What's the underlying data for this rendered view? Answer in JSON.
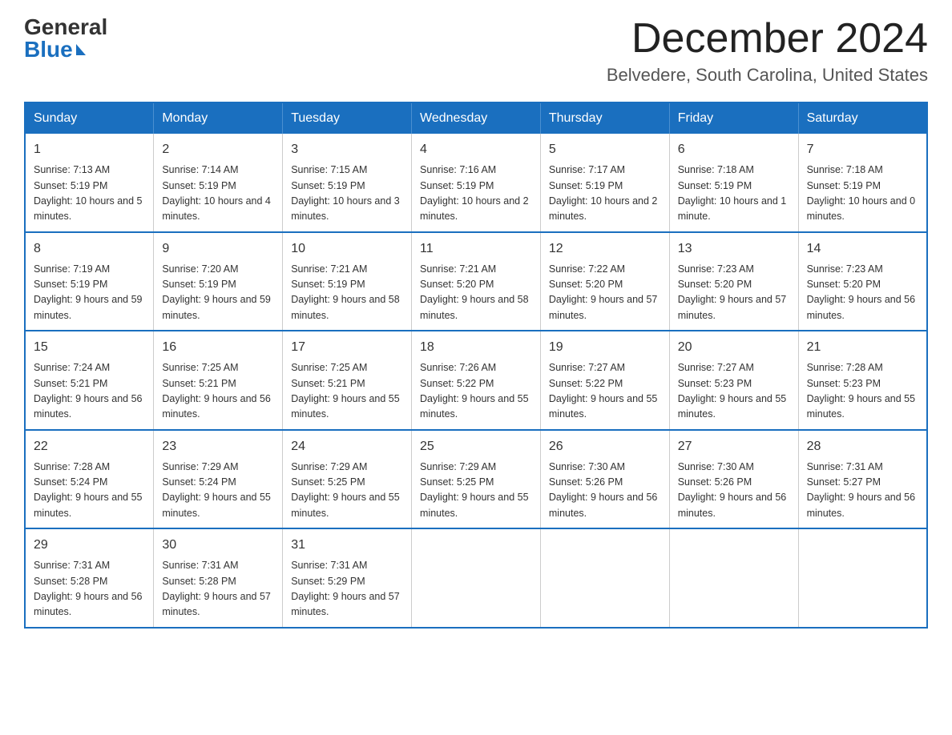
{
  "logo": {
    "general": "General",
    "blue": "Blue"
  },
  "title": "December 2024",
  "location": "Belvedere, South Carolina, United States",
  "days_of_week": [
    "Sunday",
    "Monday",
    "Tuesday",
    "Wednesday",
    "Thursday",
    "Friday",
    "Saturday"
  ],
  "weeks": [
    [
      {
        "day": "1",
        "sunrise": "7:13 AM",
        "sunset": "5:19 PM",
        "daylight": "10 hours and 5 minutes."
      },
      {
        "day": "2",
        "sunrise": "7:14 AM",
        "sunset": "5:19 PM",
        "daylight": "10 hours and 4 minutes."
      },
      {
        "day": "3",
        "sunrise": "7:15 AM",
        "sunset": "5:19 PM",
        "daylight": "10 hours and 3 minutes."
      },
      {
        "day": "4",
        "sunrise": "7:16 AM",
        "sunset": "5:19 PM",
        "daylight": "10 hours and 2 minutes."
      },
      {
        "day": "5",
        "sunrise": "7:17 AM",
        "sunset": "5:19 PM",
        "daylight": "10 hours and 2 minutes."
      },
      {
        "day": "6",
        "sunrise": "7:18 AM",
        "sunset": "5:19 PM",
        "daylight": "10 hours and 1 minute."
      },
      {
        "day": "7",
        "sunrise": "7:18 AM",
        "sunset": "5:19 PM",
        "daylight": "10 hours and 0 minutes."
      }
    ],
    [
      {
        "day": "8",
        "sunrise": "7:19 AM",
        "sunset": "5:19 PM",
        "daylight": "9 hours and 59 minutes."
      },
      {
        "day": "9",
        "sunrise": "7:20 AM",
        "sunset": "5:19 PM",
        "daylight": "9 hours and 59 minutes."
      },
      {
        "day": "10",
        "sunrise": "7:21 AM",
        "sunset": "5:19 PM",
        "daylight": "9 hours and 58 minutes."
      },
      {
        "day": "11",
        "sunrise": "7:21 AM",
        "sunset": "5:20 PM",
        "daylight": "9 hours and 58 minutes."
      },
      {
        "day": "12",
        "sunrise": "7:22 AM",
        "sunset": "5:20 PM",
        "daylight": "9 hours and 57 minutes."
      },
      {
        "day": "13",
        "sunrise": "7:23 AM",
        "sunset": "5:20 PM",
        "daylight": "9 hours and 57 minutes."
      },
      {
        "day": "14",
        "sunrise": "7:23 AM",
        "sunset": "5:20 PM",
        "daylight": "9 hours and 56 minutes."
      }
    ],
    [
      {
        "day": "15",
        "sunrise": "7:24 AM",
        "sunset": "5:21 PM",
        "daylight": "9 hours and 56 minutes."
      },
      {
        "day": "16",
        "sunrise": "7:25 AM",
        "sunset": "5:21 PM",
        "daylight": "9 hours and 56 minutes."
      },
      {
        "day": "17",
        "sunrise": "7:25 AM",
        "sunset": "5:21 PM",
        "daylight": "9 hours and 55 minutes."
      },
      {
        "day": "18",
        "sunrise": "7:26 AM",
        "sunset": "5:22 PM",
        "daylight": "9 hours and 55 minutes."
      },
      {
        "day": "19",
        "sunrise": "7:27 AM",
        "sunset": "5:22 PM",
        "daylight": "9 hours and 55 minutes."
      },
      {
        "day": "20",
        "sunrise": "7:27 AM",
        "sunset": "5:23 PM",
        "daylight": "9 hours and 55 minutes."
      },
      {
        "day": "21",
        "sunrise": "7:28 AM",
        "sunset": "5:23 PM",
        "daylight": "9 hours and 55 minutes."
      }
    ],
    [
      {
        "day": "22",
        "sunrise": "7:28 AM",
        "sunset": "5:24 PM",
        "daylight": "9 hours and 55 minutes."
      },
      {
        "day": "23",
        "sunrise": "7:29 AM",
        "sunset": "5:24 PM",
        "daylight": "9 hours and 55 minutes."
      },
      {
        "day": "24",
        "sunrise": "7:29 AM",
        "sunset": "5:25 PM",
        "daylight": "9 hours and 55 minutes."
      },
      {
        "day": "25",
        "sunrise": "7:29 AM",
        "sunset": "5:25 PM",
        "daylight": "9 hours and 55 minutes."
      },
      {
        "day": "26",
        "sunrise": "7:30 AM",
        "sunset": "5:26 PM",
        "daylight": "9 hours and 56 minutes."
      },
      {
        "day": "27",
        "sunrise": "7:30 AM",
        "sunset": "5:26 PM",
        "daylight": "9 hours and 56 minutes."
      },
      {
        "day": "28",
        "sunrise": "7:31 AM",
        "sunset": "5:27 PM",
        "daylight": "9 hours and 56 minutes."
      }
    ],
    [
      {
        "day": "29",
        "sunrise": "7:31 AM",
        "sunset": "5:28 PM",
        "daylight": "9 hours and 56 minutes."
      },
      {
        "day": "30",
        "sunrise": "7:31 AM",
        "sunset": "5:28 PM",
        "daylight": "9 hours and 57 minutes."
      },
      {
        "day": "31",
        "sunrise": "7:31 AM",
        "sunset": "5:29 PM",
        "daylight": "9 hours and 57 minutes."
      },
      null,
      null,
      null,
      null
    ]
  ],
  "labels": {
    "sunrise": "Sunrise:",
    "sunset": "Sunset:",
    "daylight": "Daylight:"
  }
}
